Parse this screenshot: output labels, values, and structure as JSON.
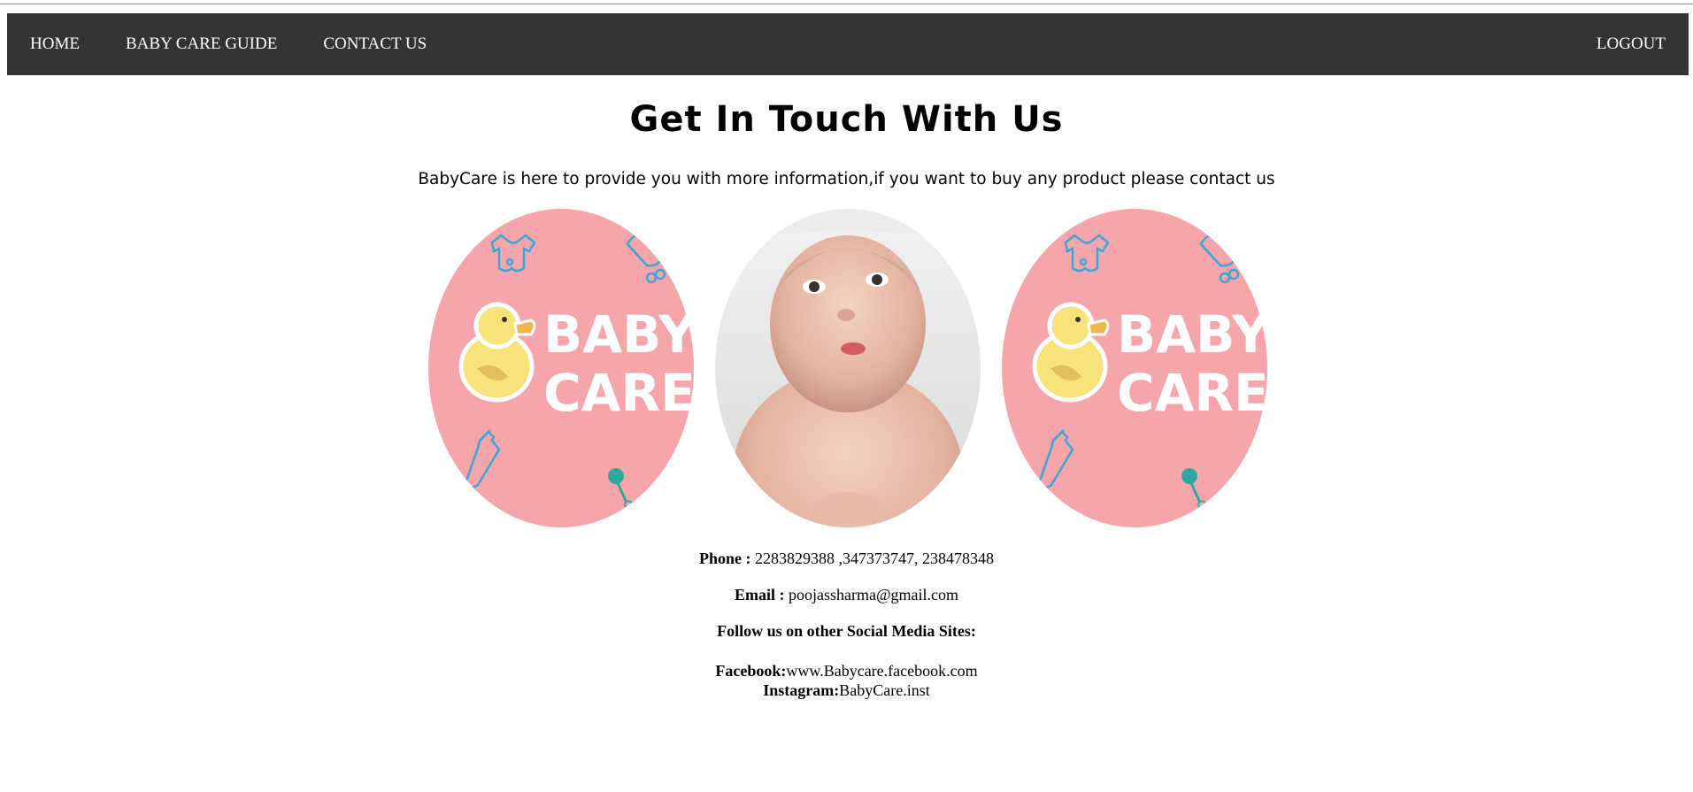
{
  "nav": {
    "home": "HOME",
    "guide": "BABY CARE GUIDE",
    "contact": "CONTACT US",
    "logout": "LOGOUT"
  },
  "main": {
    "title": "Get In Touch With Us",
    "subtitle": "BabyCare is here to provide you with more information,if you want to buy any product please contact us"
  },
  "logo": {
    "line1": "BABY",
    "line2": "CARE"
  },
  "contact": {
    "phone_label": "Phone :",
    "phone_value": " 2283829388 ,347373747, 238478348",
    "email_label": "Email :",
    "email_value": " poojassharma@gmail.com",
    "follow_text": "Follow us on other Social Media Sites:",
    "facebook_label": "Facebook:",
    "facebook_value": "www.Babycare.facebook.com",
    "instagram_label": "Instagram:",
    "instagram_value": "BabyCare.inst"
  },
  "colors": {
    "navbar": "#333333",
    "logo_pink": "#f6a5aa",
    "duck_yellow": "#f8e27a",
    "icon_blue": "#3aa7d9"
  }
}
